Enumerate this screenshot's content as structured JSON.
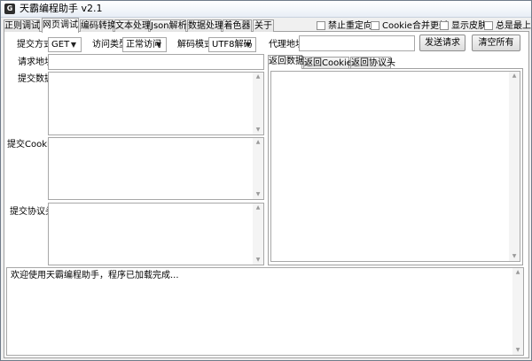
{
  "window": {
    "title": "天霸编程助手 v2.1",
    "app_icon_glyph": "G"
  },
  "tabs": [
    {
      "label": "正则调试",
      "active": false
    },
    {
      "label": "网页调试",
      "active": true
    },
    {
      "label": "编码转换",
      "active": false
    },
    {
      "label": "文本处理",
      "active": false
    },
    {
      "label": "Json解析",
      "active": false
    },
    {
      "label": "数据处理",
      "active": false
    },
    {
      "label": "着色器",
      "active": false
    },
    {
      "label": "关于",
      "active": false
    }
  ],
  "options": {
    "disable_redirect": {
      "label": "禁止重定向",
      "checked": false
    },
    "merge_cookie": {
      "label": "Cookie合并更新",
      "checked": false
    },
    "show_skin": {
      "label": "显示皮肤",
      "checked": false
    },
    "always_on_top": {
      "label": "总是最上",
      "checked": false
    }
  },
  "request": {
    "submit_method_label": "提交方式",
    "submit_method_value": "GET",
    "access_type_label": "访问类型",
    "access_type_value": "正常访问",
    "decode_mode_label": "解码模式",
    "decode_mode_value": "UTF8解码",
    "proxy_label": "代理地址",
    "proxy_value": "",
    "send_button": "发送请求",
    "clear_button": "清空所有",
    "url_label": "请求地址",
    "url_value": "",
    "post_data_label": "提交数据",
    "post_cookie_label": "提交Cookie",
    "post_headers_label": "提交协议头"
  },
  "response": {
    "tabs": [
      {
        "label": "返回数据",
        "active": true
      },
      {
        "label": "返回Cookie",
        "active": false
      },
      {
        "label": "返回协议头",
        "active": false
      }
    ]
  },
  "log": {
    "text": "欢迎使用天霸编程助手，程序已加载完成..."
  }
}
